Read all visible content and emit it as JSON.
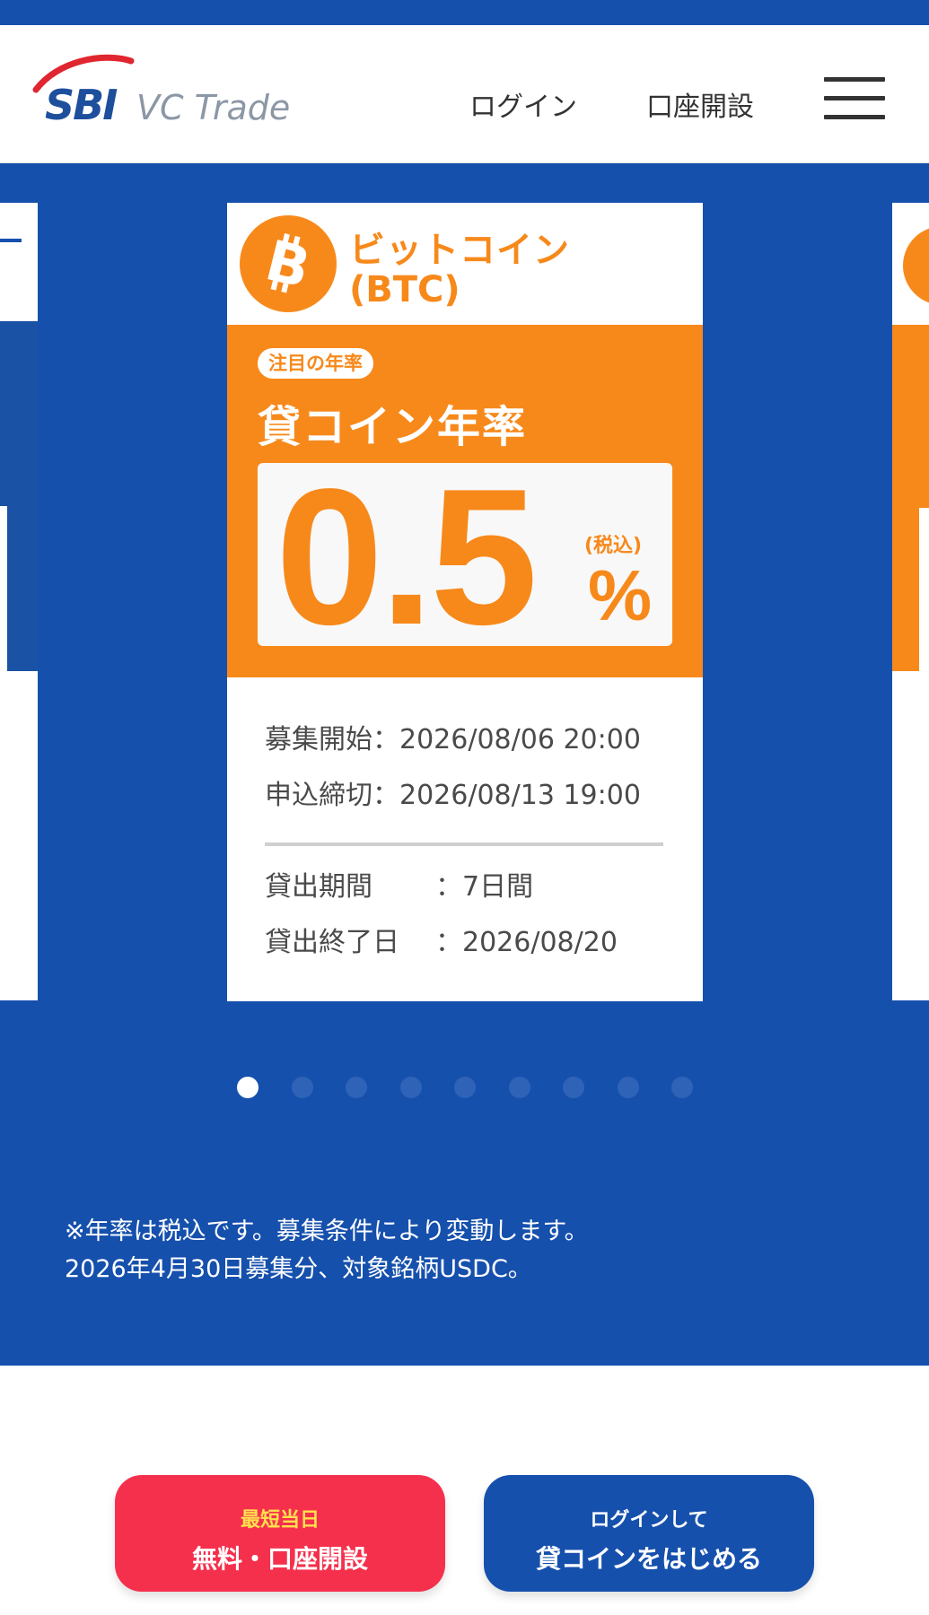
{
  "header": {
    "logo_sbi": "SBI",
    "logo_vc": "VC Trade",
    "login_label": "ログイン",
    "open_account_label": "口座開設",
    "menu_icon": "hamburger-menu-icon"
  },
  "card": {
    "coin_name": "ビットコイン",
    "coin_ticker": "(BTC)",
    "coin_icon": "bitcoin-icon",
    "badge": "注目の年率",
    "rate_title": "貸コイン年率",
    "rate_value": "0.5",
    "rate_tax": "(税込)",
    "rate_unit": "%",
    "recruit_start_label": "募集開始：",
    "recruit_start_value": "2026/08/06 20:00",
    "deadline_label": "申込締切：",
    "deadline_value": "2026/08/13 19:00",
    "period_label": "貸出期間",
    "period_value": "：7日間",
    "end_label": "貸出終了日",
    "end_value": "：2026/08/20"
  },
  "carousel": {
    "dot_count": 9,
    "active_index": 0
  },
  "note": {
    "line1": "※年率は税込です。募集条件により変動します。",
    "line2": "2026年4月30日募集分、対象銘柄USDC。"
  },
  "cta": {
    "open_small": "最短当日",
    "open_big": "無料・口座開設",
    "login_small": "ログインして",
    "login_big": "貸コインをはじめる"
  },
  "colors": {
    "brand_blue": "#1650ad",
    "orange": "#f7891b",
    "cta_pink": "#f5304d",
    "cta_yellow": "#ffe14d"
  }
}
